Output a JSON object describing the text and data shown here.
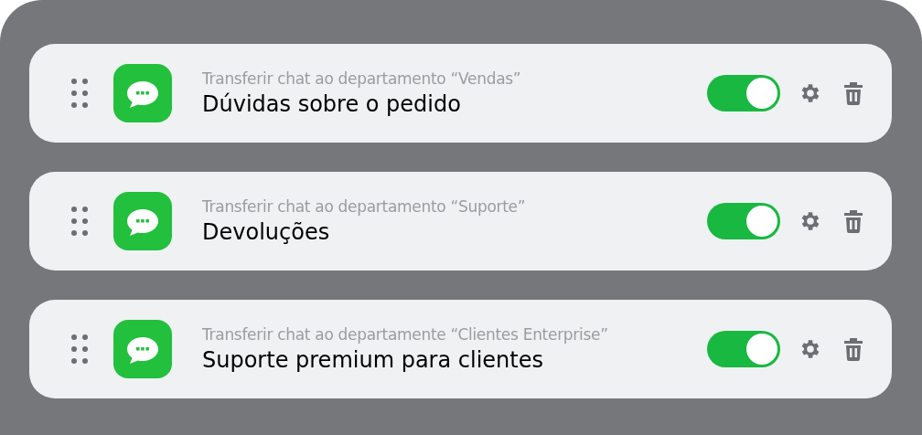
{
  "rules": [
    {
      "subtitle": "Transferir chat ao departamento “Vendas”",
      "title": "Dúvidas sobre o pedido",
      "on": true
    },
    {
      "subtitle": "Transferir chat ao departamento “Suporte”",
      "title": "Devoluções",
      "on": true
    },
    {
      "subtitle": "Transferir chat ao departamente “Clientes Enterprise”",
      "title": "Suporte premium para clientes",
      "on": true
    }
  ]
}
